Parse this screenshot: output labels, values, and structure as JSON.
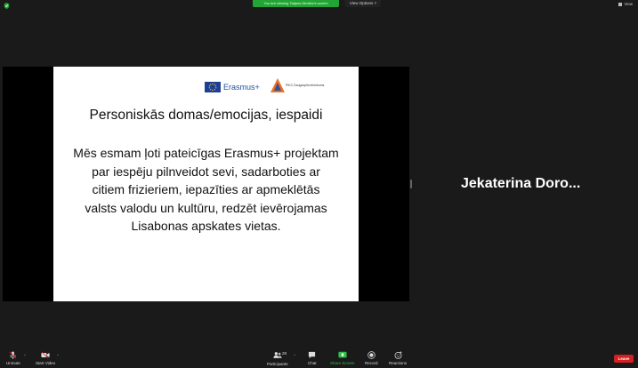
{
  "topbar": {
    "viewing_text": "You are viewing Tatjana Dimitric's screen",
    "view_options_label": "View Options",
    "view_label": "View"
  },
  "slide": {
    "erasmus_label": "Erasmus+",
    "pikc_label": "PIKC Daugavpils tehnikums",
    "title": "Personiskās domas/emocijas, iespaidi",
    "body_lines": [
      "Mēs esmam ļoti pateicīgas Erasmus+ projektam",
      "par iespēju pilnveidot sevi, sadarboties ar",
      "citiem frizieriem, iepazīties ar apmeklētās",
      "valsts valodu un kultūru, redzēt ievērojamas",
      "Lisabonas apskates vietas."
    ]
  },
  "participant": {
    "name": "Jekaterina  Doro..."
  },
  "toolbar": {
    "unmute_label": "Unmute",
    "start_video_label": "Start Video",
    "participants_label": "Participants",
    "participants_count": "28",
    "chat_label": "Chat",
    "share_screen_label": "Share Screen",
    "record_label": "Record",
    "reactions_label": "Reactions",
    "leave_label": "Leave"
  },
  "colors": {
    "share_screen_green": "#2fbf48",
    "leave_red": "#d32020",
    "viewing_green": "#23a536"
  },
  "icons": [
    "shield-icon",
    "grid-view-icon",
    "microphone-muted-icon",
    "video-off-icon",
    "participants-icon",
    "chat-icon",
    "share-screen-icon",
    "record-icon",
    "reactions-icon",
    "caret-up-icon"
  ]
}
